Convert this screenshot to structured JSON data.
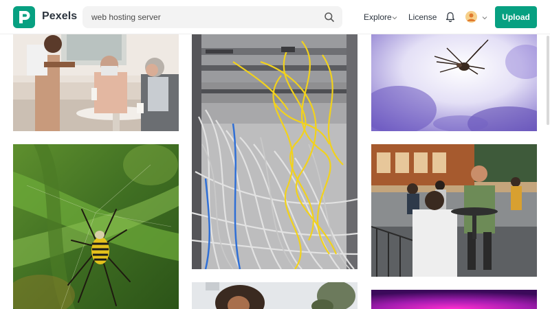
{
  "header": {
    "brand": "Pexels",
    "search_value": "web hosting server",
    "nav": {
      "explore": "Explore",
      "license": "License"
    },
    "upload_label": "Upload",
    "icons": {
      "logo": "pexels-logo-icon",
      "search": "search-icon",
      "bell": "bell-icon",
      "chevron": "chevron-down-icon",
      "avatar": "avatar"
    }
  },
  "colors": {
    "brand": "#07a081",
    "text": "#2c343e",
    "search_bg": "#f3f3f3"
  },
  "photos": [
    {
      "name": "photo-waiter-serving-couple"
    },
    {
      "name": "photo-server-rack-cables"
    },
    {
      "name": "photo-spider-sky"
    },
    {
      "name": "photo-garden-spider"
    },
    {
      "name": "photo-street-cafe"
    },
    {
      "name": "photo-woman-curly-hair"
    },
    {
      "name": "photo-purple-abstract"
    }
  ]
}
